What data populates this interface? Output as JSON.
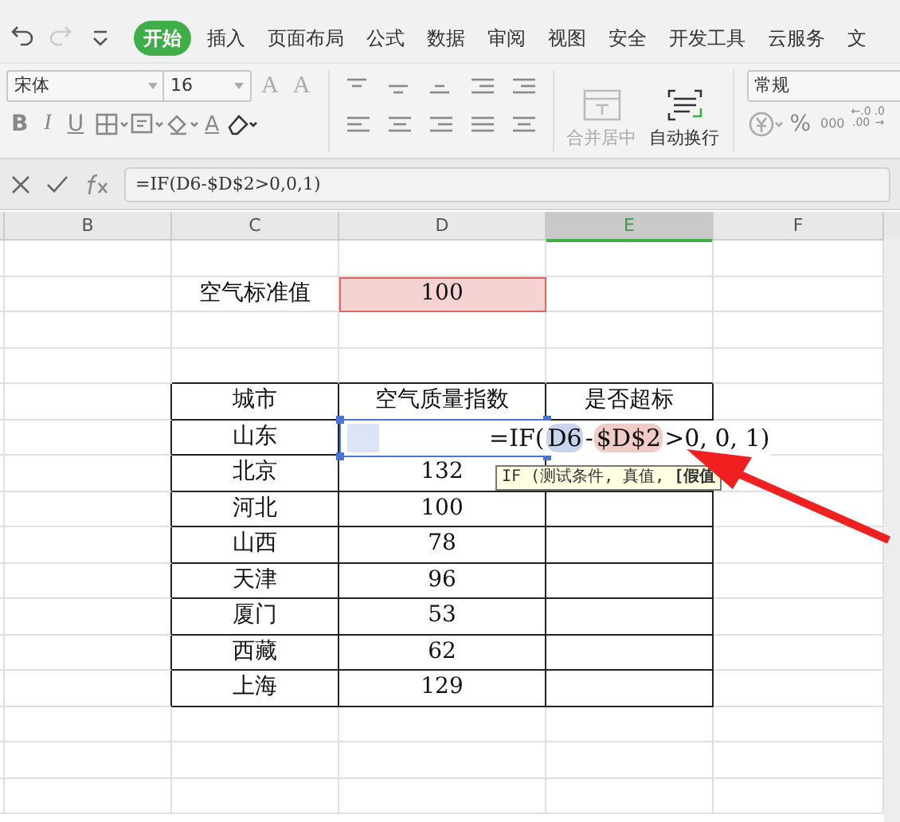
{
  "quick_access": [
    {
      "kind": "undo",
      "disabled": false
    },
    {
      "kind": "redo",
      "disabled": true
    },
    {
      "kind": "customize",
      "disabled": false
    }
  ],
  "tabs": [
    {
      "label": "开始",
      "selected": true
    },
    {
      "label": "插入",
      "selected": false
    },
    {
      "label": "页面布局",
      "selected": false
    },
    {
      "label": "公式",
      "selected": false
    },
    {
      "label": "数据",
      "selected": false
    },
    {
      "label": "审阅",
      "selected": false
    },
    {
      "label": "视图",
      "selected": false
    },
    {
      "label": "安全",
      "selected": false
    },
    {
      "label": "开发工具",
      "selected": false
    },
    {
      "label": "云服务",
      "selected": false
    },
    {
      "label": "文",
      "selected": false
    }
  ],
  "font": {
    "name": "宋体",
    "size": "16",
    "grow": "A",
    "shrink": "A"
  },
  "format_buttons": [
    {
      "kind": "bold",
      "label": "B"
    },
    {
      "kind": "italic",
      "label": "I"
    },
    {
      "kind": "underline",
      "label": "U"
    }
  ],
  "font_color": "A",
  "merge_button": {
    "label": "合并居中",
    "disabled": true
  },
  "wrap_button": {
    "label": "自动换行",
    "disabled": false
  },
  "number_format": "常规",
  "number_buttons": [
    {
      "kind": "percent",
      "label": "%"
    },
    {
      "kind": "thousands",
      "label": "000"
    },
    {
      "kind": "decimal",
      "top": "←.0",
      "bottom": ".00"
    },
    {
      "kind": "decimal",
      "top": ".0",
      "bottom": "→"
    }
  ],
  "formula_bar": {
    "formula": "=IF(D6-$D$2>0,0,1)"
  },
  "columns": [
    {
      "label": "B",
      "selected": false
    },
    {
      "label": "C",
      "selected": false
    },
    {
      "label": "D",
      "selected": false
    },
    {
      "label": "E",
      "selected": true
    },
    {
      "label": "F",
      "selected": false
    }
  ],
  "standard_value": {
    "label": "空气标准值",
    "value": "100"
  },
  "table": {
    "columns": [
      "城市",
      "空气质量指数",
      "是否超标"
    ],
    "rows": [
      {
        "city": "山东",
        "aqi": "",
        "editing": true
      },
      {
        "city": "北京",
        "aqi": "132",
        "editing": false
      },
      {
        "city": "河北",
        "aqi": "100",
        "editing": false
      },
      {
        "city": "山西",
        "aqi": "78",
        "editing": false
      },
      {
        "city": "天津",
        "aqi": "96",
        "editing": false
      },
      {
        "city": "厦门",
        "aqi": "53",
        "editing": false
      },
      {
        "city": "西藏",
        "aqi": "62",
        "editing": false
      },
      {
        "city": "上海",
        "aqi": "129",
        "editing": false
      }
    ]
  },
  "editor": {
    "parts": [
      {
        "text": "=IF("
      },
      {
        "text": "D6",
        "color": "#c9d4ee"
      },
      {
        "text": "-"
      },
      {
        "text": "$D$2",
        "color": "#f1cbc8"
      },
      {
        "text": ">0, 0, 1)"
      }
    ]
  },
  "tooltip": "IF (测试条件, 真值, **[假值**"
}
